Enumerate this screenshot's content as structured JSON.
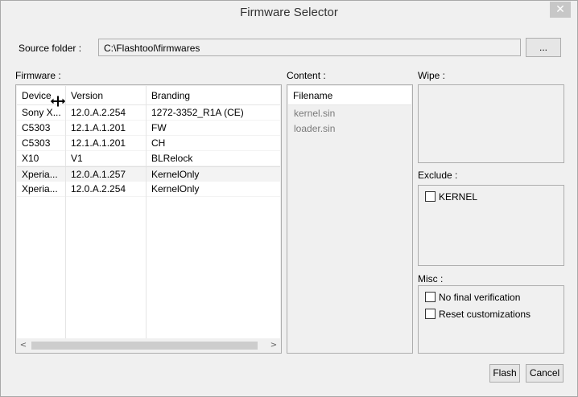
{
  "window": {
    "title": "Firmware Selector",
    "close_glyph": "✕"
  },
  "source": {
    "label": "Source folder :",
    "value": "C:\\Flashtool\\firmwares",
    "browse_label": "..."
  },
  "firmware": {
    "label": "Firmware :",
    "columns": [
      "Device",
      "Version",
      "Branding"
    ],
    "rows": [
      [
        "Sony X...",
        "12.0.A.2.254",
        "1272-3352_R1A (CE)"
      ],
      [
        "C5303",
        "12.1.A.1.201",
        "FW"
      ],
      [
        "C5303",
        "12.1.A.1.201",
        "CH"
      ],
      [
        "X10",
        "V1",
        "BLRelock"
      ],
      [
        "Xperia...",
        "12.0.A.1.257",
        "KernelOnly"
      ],
      [
        "Xperia...",
        "12.0.A.2.254",
        "KernelOnly"
      ]
    ],
    "scroll_left": "<",
    "scroll_right": ">"
  },
  "content": {
    "label": "Content :",
    "header": "Filename",
    "files": [
      "kernel.sin",
      "loader.sin"
    ]
  },
  "wipe": {
    "label": "Wipe :"
  },
  "exclude": {
    "label": "Exclude :",
    "items": [
      "KERNEL"
    ]
  },
  "misc": {
    "label": "Misc :",
    "items": [
      "No final verification",
      "Reset customizations"
    ]
  },
  "buttons": {
    "flash": "Flash",
    "cancel": "Cancel"
  }
}
